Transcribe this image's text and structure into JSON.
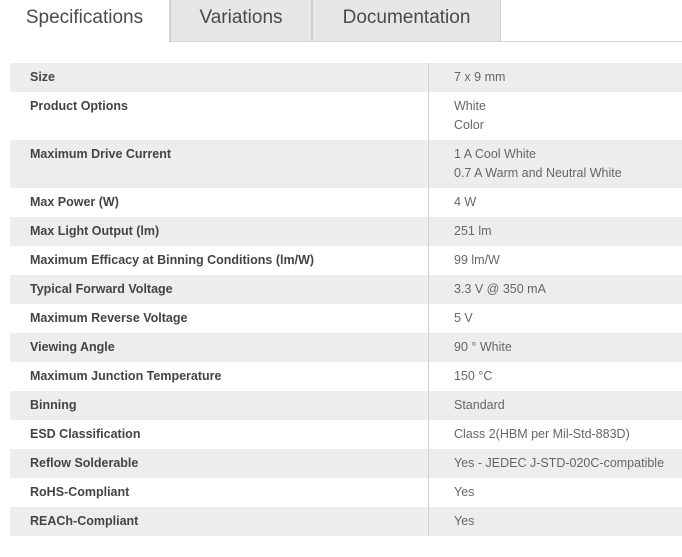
{
  "tabs": [
    {
      "label": "Specifications",
      "active": true
    },
    {
      "label": "Variations",
      "active": false
    },
    {
      "label": "Documentation",
      "active": false
    }
  ],
  "specs": [
    {
      "key": "Size",
      "values": [
        "7 x 9 mm"
      ]
    },
    {
      "key": "Product Options",
      "values": [
        "White",
        "Color"
      ]
    },
    {
      "key": "Maximum Drive Current",
      "values": [
        "1 A Cool White",
        "0.7 A Warm and Neutral White"
      ]
    },
    {
      "key": "Max Power (W)",
      "values": [
        "4 W"
      ]
    },
    {
      "key": "Max Light Output (lm)",
      "values": [
        "251 lm"
      ]
    },
    {
      "key": "Maximum Efficacy at Binning Conditions (lm/W)",
      "values": [
        "99 lm/W"
      ]
    },
    {
      "key": "Typical Forward Voltage",
      "values": [
        "3.3 V @ 350 mA"
      ]
    },
    {
      "key": "Maximum Reverse Voltage",
      "values": [
        "5 V"
      ]
    },
    {
      "key": "Viewing Angle",
      "values": [
        "90 ° White"
      ]
    },
    {
      "key": "Maximum Junction Temperature",
      "values": [
        "150 °C"
      ]
    },
    {
      "key": "Binning",
      "values": [
        "Standard"
      ]
    },
    {
      "key": "ESD Classification",
      "values": [
        "Class 2(HBM per Mil-Std-883D)"
      ]
    },
    {
      "key": "Reflow Solderable",
      "values": [
        "Yes - JEDEC J-STD-020C-compatible"
      ]
    },
    {
      "key": "RoHS-Compliant",
      "values": [
        "Yes"
      ]
    },
    {
      "key": "REACh-Compliant",
      "values": [
        "Yes"
      ]
    }
  ]
}
